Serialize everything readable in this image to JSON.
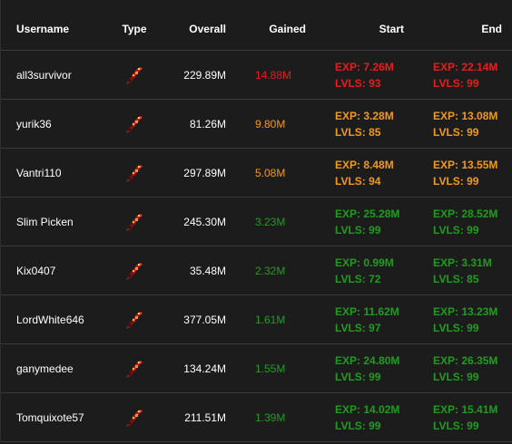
{
  "header": {
    "username": "Username",
    "type": "Type",
    "overall": "Overall",
    "gained": "Gained",
    "start": "Start",
    "end": "End"
  },
  "colors": {
    "high": "#e81c1c",
    "mid": "#f09a16",
    "low": "#1f9c1f"
  },
  "rows": [
    {
      "username": "all3survivor",
      "type_icon": "hardcore-ironman-icon",
      "overall": "229.89M",
      "gained": "14.88M",
      "start_exp": "EXP: 7.26M",
      "start_lvls": "LVLS: 93",
      "end_exp": "EXP: 22.14M",
      "end_lvls": "LVLS: 99",
      "color": "red"
    },
    {
      "username": "yurik36",
      "type_icon": "hardcore-ironman-icon",
      "overall": "81.26M",
      "gained": "9.80M",
      "start_exp": "EXP: 3.28M",
      "start_lvls": "LVLS: 85",
      "end_exp": "EXP: 13.08M",
      "end_lvls": "LVLS: 99",
      "color": "orange"
    },
    {
      "username": "Vantri110",
      "type_icon": "hardcore-ironman-icon",
      "overall": "297.89M",
      "gained": "5.08M",
      "start_exp": "EXP: 8.48M",
      "start_lvls": "LVLS: 94",
      "end_exp": "EXP: 13.55M",
      "end_lvls": "LVLS: 99",
      "color": "orange"
    },
    {
      "username": "Slim Picken",
      "type_icon": "hardcore-ironman-icon",
      "overall": "245.30M",
      "gained": "3.23M",
      "start_exp": "EXP: 25.28M",
      "start_lvls": "LVLS: 99",
      "end_exp": "EXP: 28.52M",
      "end_lvls": "LVLS: 99",
      "color": "green"
    },
    {
      "username": "Kix0407",
      "type_icon": "hardcore-ironman-icon",
      "overall": "35.48M",
      "gained": "2.32M",
      "start_exp": "EXP: 0.99M",
      "start_lvls": "LVLS: 72",
      "end_exp": "EXP: 3.31M",
      "end_lvls": "LVLS: 85",
      "color": "green"
    },
    {
      "username": "LordWhite646",
      "type_icon": "hardcore-ironman-icon",
      "overall": "377.05M",
      "gained": "1.61M",
      "start_exp": "EXP: 11.62M",
      "start_lvls": "LVLS: 97",
      "end_exp": "EXP: 13.23M",
      "end_lvls": "LVLS: 99",
      "color": "green"
    },
    {
      "username": "ganymedee",
      "type_icon": "hardcore-ironman-icon",
      "overall": "134.24M",
      "gained": "1.55M",
      "start_exp": "EXP: 24.80M",
      "start_lvls": "LVLS: 99",
      "end_exp": "EXP: 26.35M",
      "end_lvls": "LVLS: 99",
      "color": "green"
    },
    {
      "username": "Tomquixote57",
      "type_icon": "hardcore-ironman-icon",
      "overall": "211.51M",
      "gained": "1.39M",
      "start_exp": "EXP: 14.02M",
      "start_lvls": "LVLS: 99",
      "end_exp": "EXP: 15.41M",
      "end_lvls": "LVLS: 99",
      "color": "green"
    }
  ]
}
